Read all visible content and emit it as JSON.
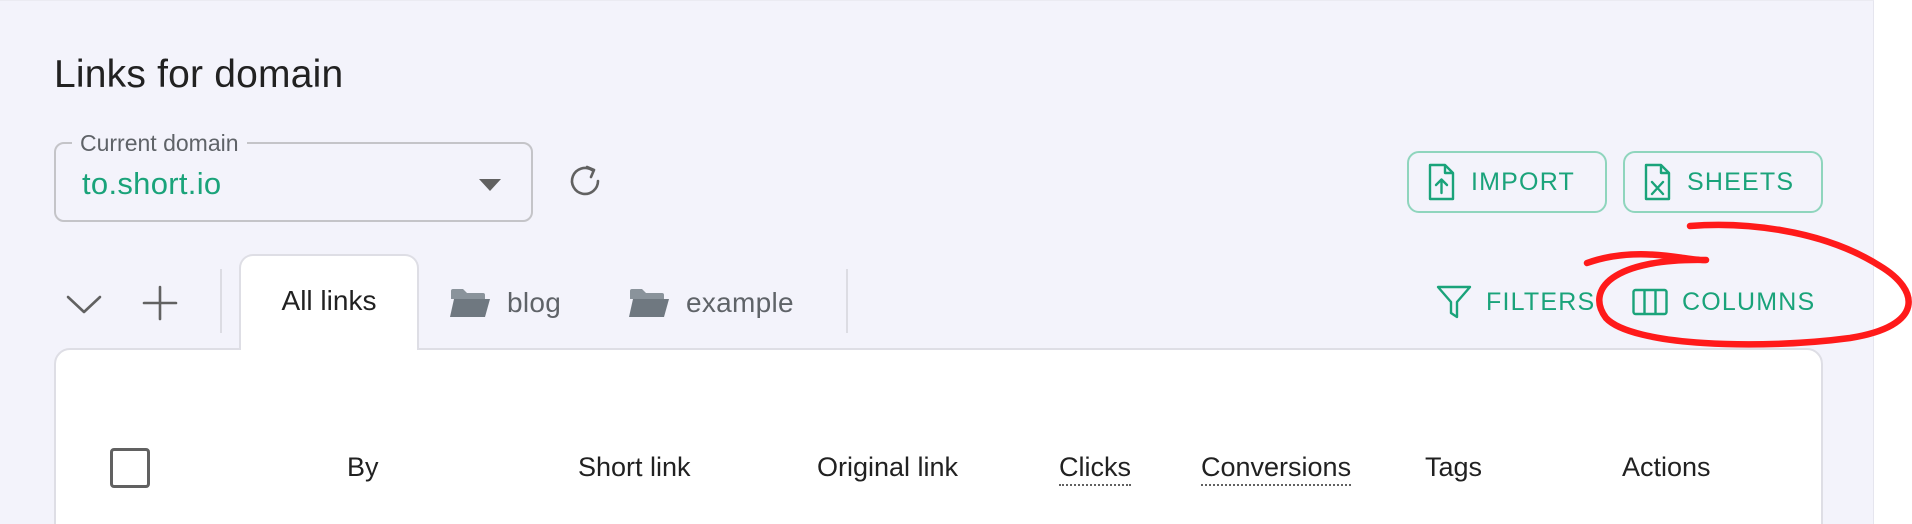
{
  "page": {
    "title": "Links for domain"
  },
  "domain_select": {
    "label": "Current domain",
    "value": "to.short.io"
  },
  "header_actions": {
    "import_label": "IMPORT",
    "sheets_label": "SHEETS"
  },
  "tabs": [
    {
      "label": "All links",
      "active": true
    },
    {
      "label": "blog",
      "icon": "folder-icon"
    },
    {
      "label": "example",
      "icon": "folder-icon"
    }
  ],
  "toolbar": {
    "filters_label": "FILTERS",
    "columns_label": "COLUMNS"
  },
  "table": {
    "columns": [
      "By",
      "Short link",
      "Original link",
      "Clicks",
      "Conversions",
      "Tags",
      "Actions"
    ]
  },
  "colors": {
    "accent": "#1aa37a",
    "accent_border": "#8fd5bd",
    "panel_bg": "#f3f3fb",
    "annotation_red": "#ff1a1a",
    "folder_icon": "#6f7880"
  }
}
